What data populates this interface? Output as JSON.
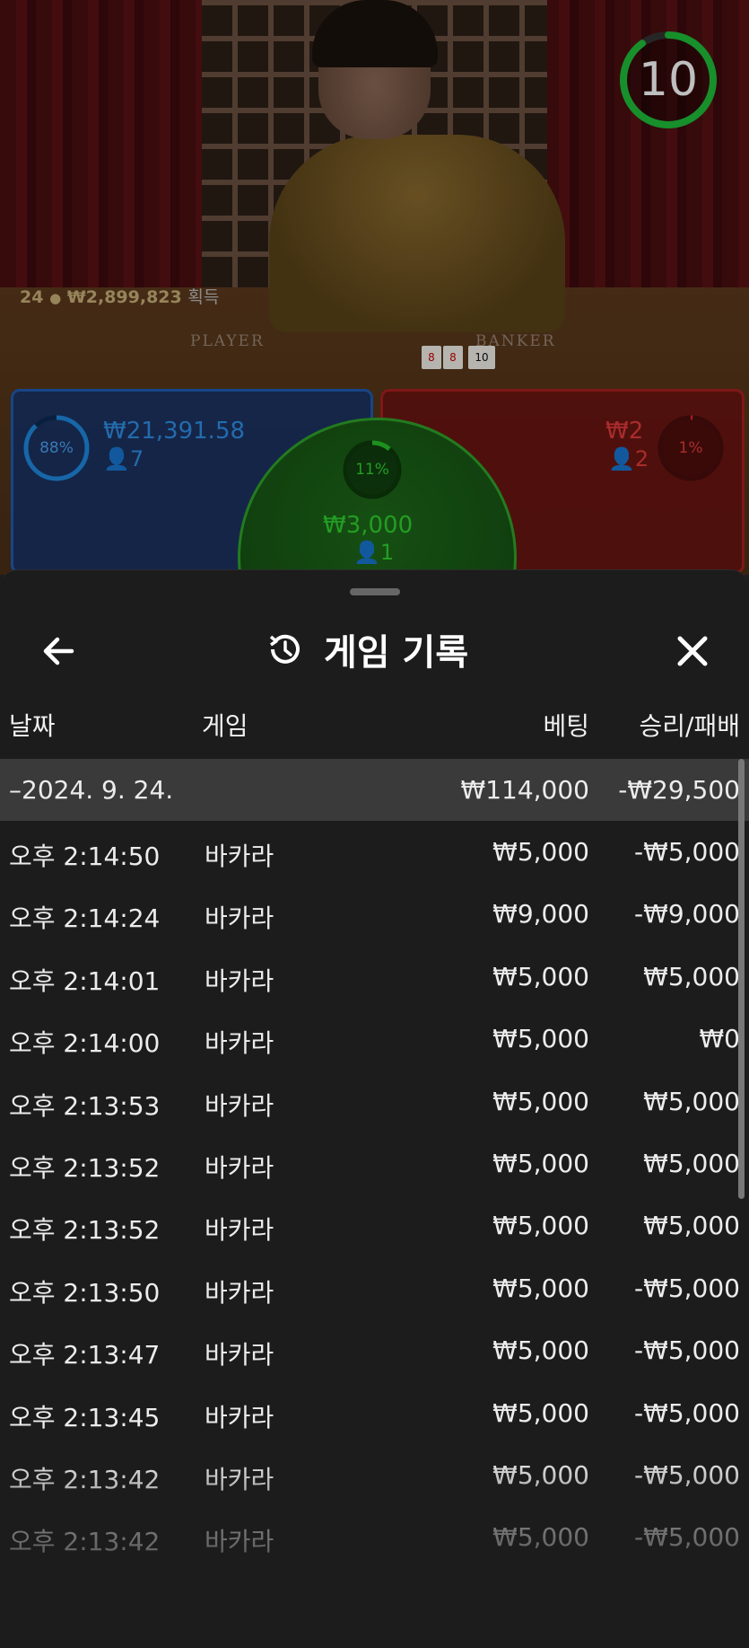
{
  "video": {
    "timer": "10",
    "timer_fraction": 0.9,
    "felt_left": "PLAYER",
    "felt_right": "BANKER",
    "winners_count": "24",
    "winners_amount": "₩2,899,823",
    "winners_suffix": "획득",
    "cards": [
      "8",
      "8",
      "10"
    ]
  },
  "bets": {
    "player": {
      "percent": "88%",
      "percent_value": 88,
      "amount": "₩21,391.58",
      "players": "7",
      "color": "#1f8ae0"
    },
    "tie": {
      "percent": "11%",
      "percent_value": 11,
      "amount": "₩3,000",
      "players": "1",
      "color": "#27c22a"
    },
    "banker": {
      "percent": "1%",
      "percent_value": 1,
      "amount": "₩2",
      "players": "2",
      "color": "#d92a2a"
    }
  },
  "history": {
    "title": "게임 기록",
    "title_icon": "history-icon",
    "back_icon": "arrow-left-icon",
    "close_icon": "close-icon",
    "columns": {
      "date": "날짜",
      "game": "게임",
      "bet": "베팅",
      "result": "승리/패배"
    },
    "summary": {
      "date": "–2024. 9. 24.",
      "bet": "₩114,000",
      "result": "-₩29,500"
    },
    "rows": [
      {
        "time": "오후 2:14:50",
        "game": "바카라",
        "bet": "₩5,000",
        "result": "-₩5,000"
      },
      {
        "time": "오후 2:14:24",
        "game": "바카라",
        "bet": "₩9,000",
        "result": "-₩9,000"
      },
      {
        "time": "오후 2:14:01",
        "game": "바카라",
        "bet": "₩5,000",
        "result": "₩5,000"
      },
      {
        "time": "오후 2:14:00",
        "game": "바카라",
        "bet": "₩5,000",
        "result": "₩0"
      },
      {
        "time": "오후 2:13:53",
        "game": "바카라",
        "bet": "₩5,000",
        "result": "₩5,000"
      },
      {
        "time": "오후 2:13:52",
        "game": "바카라",
        "bet": "₩5,000",
        "result": "₩5,000"
      },
      {
        "time": "오후 2:13:52",
        "game": "바카라",
        "bet": "₩5,000",
        "result": "₩5,000"
      },
      {
        "time": "오후 2:13:50",
        "game": "바카라",
        "bet": "₩5,000",
        "result": "-₩5,000"
      },
      {
        "time": "오후 2:13:47",
        "game": "바카라",
        "bet": "₩5,000",
        "result": "-₩5,000"
      },
      {
        "time": "오후 2:13:45",
        "game": "바카라",
        "bet": "₩5,000",
        "result": "-₩5,000"
      },
      {
        "time": "오후 2:13:42",
        "game": "바카라",
        "bet": "₩5,000",
        "result": "-₩5,000"
      },
      {
        "time": "오후 2:13:42",
        "game": "바카라",
        "bet": "₩5,000",
        "result": "-₩5,000"
      }
    ]
  }
}
